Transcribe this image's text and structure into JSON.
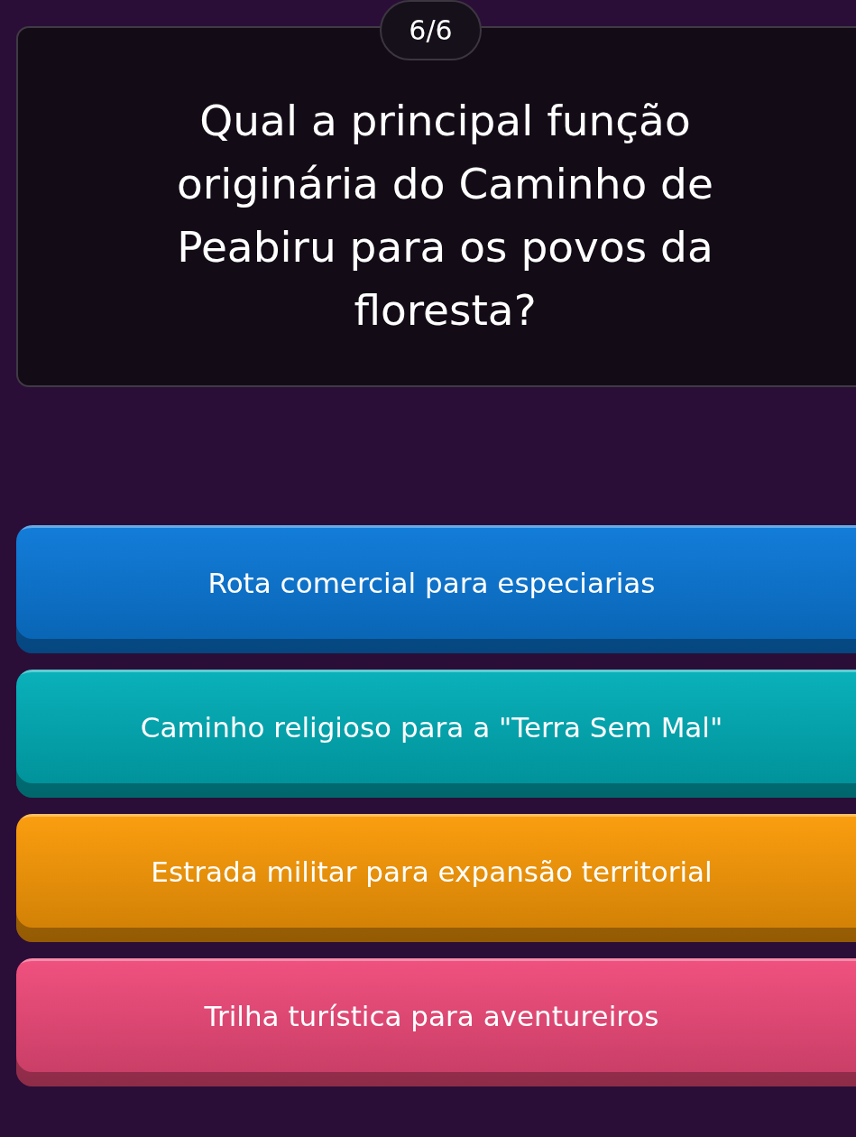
{
  "progress": "6/6",
  "question": "Qual a principal função originária do Caminho de Peabiru para os povos da floresta?",
  "answers": [
    {
      "text": "Rota comercial para especiarias",
      "color": "#0a78d8"
    },
    {
      "text": "Caminho religioso para a \"Terra Sem Mal\"",
      "color": "#00aeb8"
    },
    {
      "text": "Estrada militar para expansão territorial",
      "color": "#fb9a06"
    },
    {
      "text": "Trilha turística para aventureiros",
      "color": "#f04a7a"
    }
  ]
}
